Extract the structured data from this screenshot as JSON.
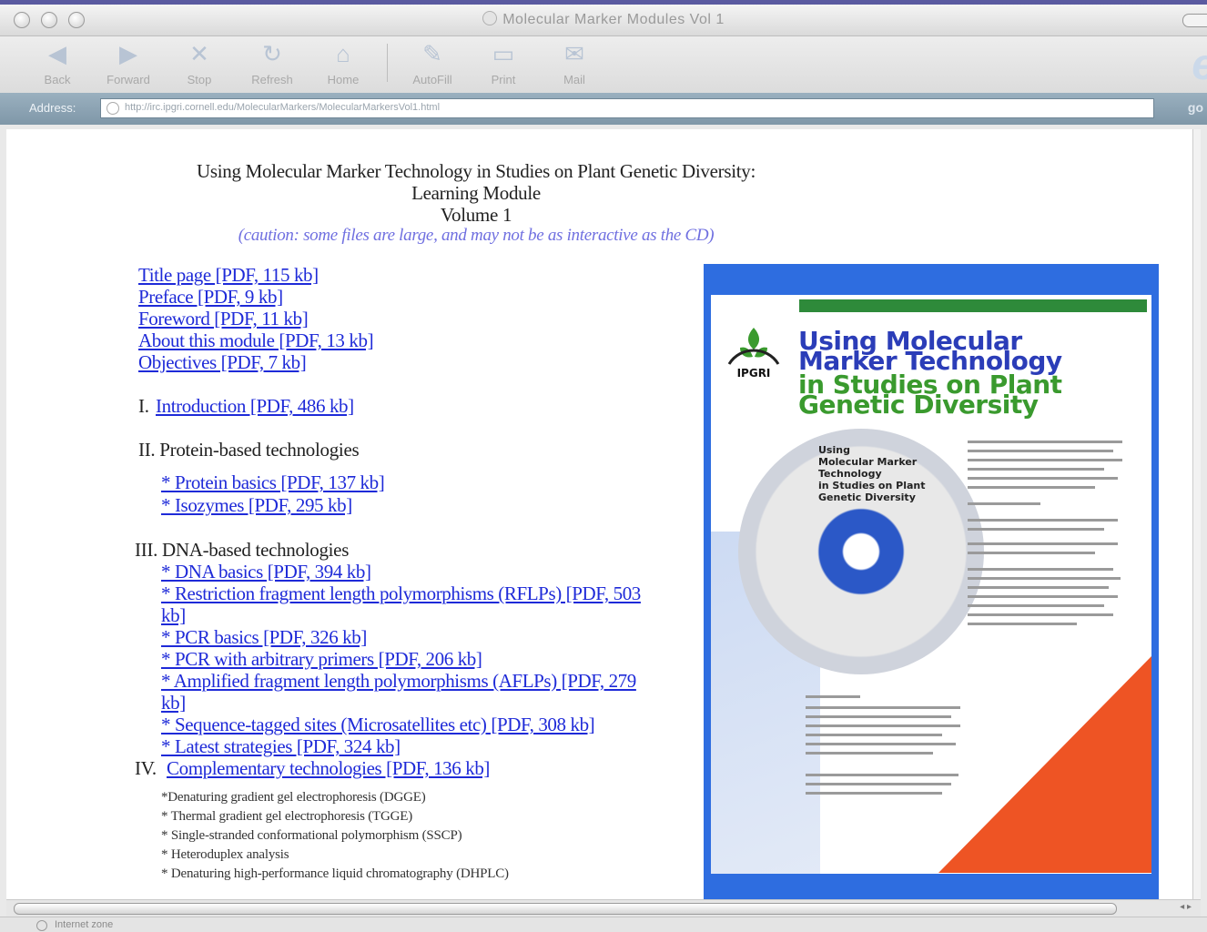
{
  "window": {
    "title": "Molecular Marker Modules Vol 1"
  },
  "toolbar": {
    "back": "Back",
    "forward": "Forward",
    "stop": "Stop",
    "refresh": "Refresh",
    "home": "Home",
    "autofill": "AutoFill",
    "print": "Print",
    "mail": "Mail"
  },
  "address": {
    "label": "Address:",
    "url": "http://irc.ipgri.cornell.edu/MolecularMarkers/MolecularMarkersVol1.html",
    "go": "go"
  },
  "page": {
    "heading": [
      "Using Molecular Marker Technology in Studies on Plant Genetic Diversity:",
      "Learning Module",
      "Volume 1"
    ],
    "caution": "(caution: some files are large, and may not be as interactive as the CD)",
    "front_links": [
      "Title page [PDF, 115 kb]",
      "Preface [PDF, 9 kb]",
      "Foreword [PDF, 11 kb]",
      "About this module [PDF, 13 kb]",
      "Objectives [PDF, 7 kb]"
    ],
    "section1": {
      "label": "I.",
      "link": "Introduction [PDF, 486 kb]"
    },
    "section2": {
      "label": "II. Protein-based technologies",
      "links": [
        "* Protein basics [PDF, 137 kb]",
        "* Isozymes [PDF, 295 kb]"
      ]
    },
    "section3": {
      "label": "III. DNA-based technologies",
      "links": [
        "* DNA basics [PDF, 394 kb]",
        "* Restriction fragment length polymorphisms (RFLPs) [PDF, 503",
        "kb]",
        "* PCR basics [PDF, 326 kb]",
        "* PCR with arbitrary primers [PDF, 206 kb]",
        "* Amplified fragment length polymorphisms (AFLPs) [PDF, 279",
        "kb]",
        "* Sequence-tagged sites (Microsatellites etc) [PDF, 308 kb]",
        "* Latest strategies [PDF, 324 kb]"
      ]
    },
    "section4": {
      "label": "IV.",
      "link": "Complementary technologies [PDF, 136 kb]",
      "items": [
        "*Denaturing gradient gel electrophoresis (DGGE)",
        "* Thermal gradient gel electrophoresis (TGGE)",
        "* Single-stranded conformational polymorphism (SSCP)",
        "* Heteroduplex analysis",
        "* Denaturing high-performance liquid chromatography (DHPLC)"
      ]
    }
  },
  "cover": {
    "logo": "IPGRI",
    "title_lines": [
      "Using Molecular",
      "Marker Technology",
      "in Studies on Plant",
      "Genetic Diversity"
    ],
    "disc_lines": [
      "Using",
      "Molecular Marker",
      "Technology",
      "in Studies on Plant",
      "Genetic Diversity"
    ],
    "colors": {
      "frame": "#2e6de0",
      "title_blue": "#2b3db8",
      "title_green": "#3a9a2e",
      "corner": "#ee5424"
    }
  },
  "status": {
    "text": "Internet zone"
  }
}
